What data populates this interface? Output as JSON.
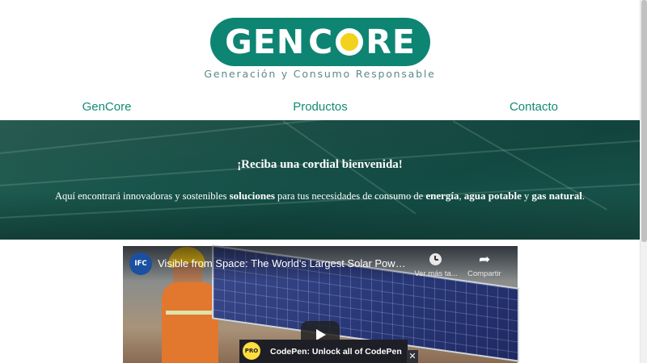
{
  "header": {
    "logo_text_left": "GEN",
    "logo_text_right": "CRE",
    "logo_alt": "GENCORE",
    "tagline": "Generación y Consumo Responsable",
    "logo_color": "#0e8573",
    "sun_color": "#f2d21b"
  },
  "nav": {
    "items": [
      {
        "label": "GenCore"
      },
      {
        "label": "Productos"
      },
      {
        "label": "Contacto"
      }
    ],
    "color": "#138a76"
  },
  "hero": {
    "title": "¡Reciba una cordial bienvenida!",
    "text_parts": {
      "p1": "Aquí encontrará innovadoras y sostenibles ",
      "b1": "soluciones",
      "p2": " para tus necesidades de consumo de ",
      "b2": "energía",
      "p3": ", ",
      "b3": "agua potable",
      "p4": " y ",
      "b4": "gas natural",
      "p5": "."
    }
  },
  "video": {
    "channel_icon_label": "IFC",
    "title": "Visible from Space: The World's Largest Solar Power ...",
    "watch_later_label": "Ver más ta...",
    "share_label": "Compartir",
    "share_icon": "share-icon",
    "clock_icon": "clock-icon"
  },
  "codepen_banner": {
    "badge": "PRO",
    "text": "CodePen: Unlock all of CodePen",
    "close": "✕"
  }
}
